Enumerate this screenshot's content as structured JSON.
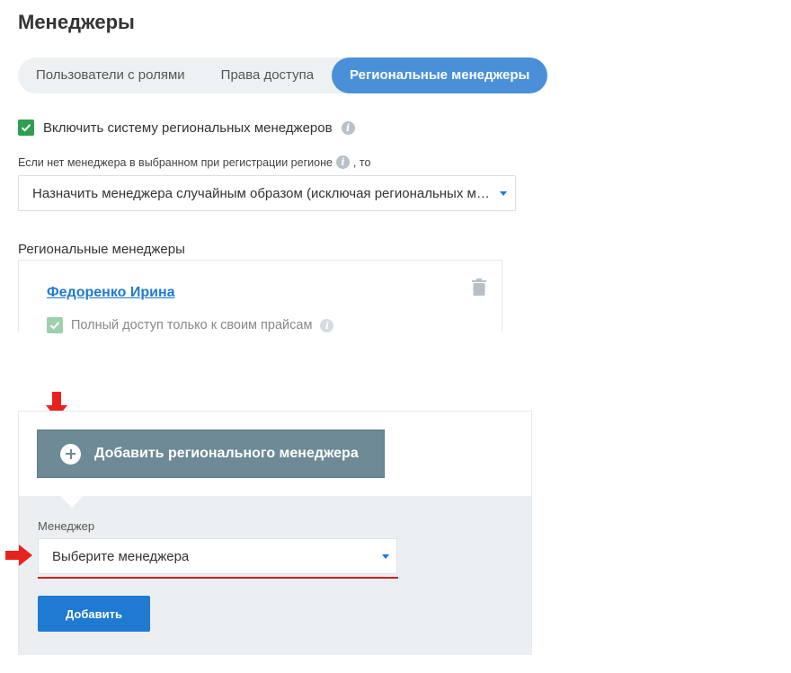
{
  "page": {
    "title": "Менеджеры"
  },
  "tabs": [
    {
      "label": "Пользователи с ролями",
      "active": false
    },
    {
      "label": "Права доступа",
      "active": false
    },
    {
      "label": "Региональные менеджеры",
      "active": true
    }
  ],
  "settings": {
    "enable_label": "Включить систему региональных менеджеров",
    "enable_checked": true,
    "hint_prefix": "Если нет менеджера в выбранном при регистрации регионе",
    "hint_suffix": ", то",
    "fallback_value": "Назначить менеджера случайным образом (исключая региональных менеджеров)"
  },
  "regional_managers": {
    "section_label": "Региональные менеджеры",
    "items": [
      {
        "name": "Федоренко Ирина",
        "access_label": "Полный доступ только к своим прайсам",
        "access_checked": true
      }
    ]
  },
  "add_panel": {
    "add_button_label": "Добавить регионального менеджера",
    "manager_field_label": "Менеджер",
    "manager_select_placeholder": "Выберите менеджера",
    "submit_label": "Добавить"
  },
  "colors": {
    "accent": "#1f7ad1",
    "tab_active": "#4a90d9",
    "checkbox": "#2e9e4f",
    "add_button": "#6d8a96",
    "annotation_red": "#d21d1d"
  },
  "icons": {
    "info": "info-icon",
    "trash": "trash-icon",
    "plus": "plus-circle-icon",
    "caret": "caret-down-icon",
    "check": "checkmark-icon",
    "annotation_down": "arrow-down-annotation-icon",
    "annotation_right": "arrow-right-annotation-icon"
  }
}
